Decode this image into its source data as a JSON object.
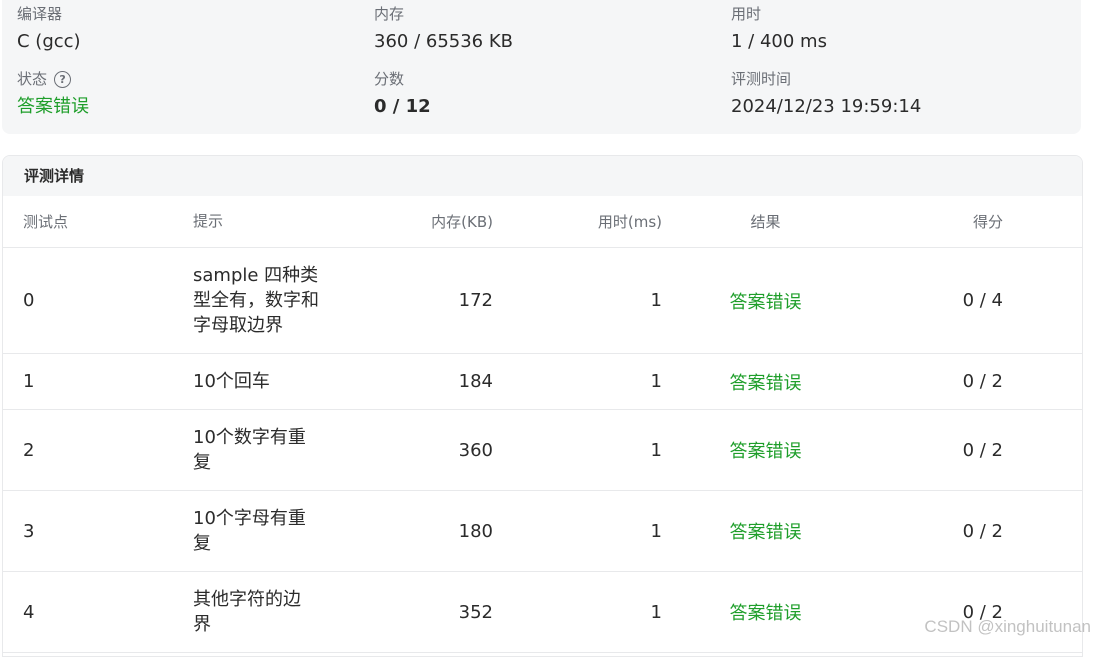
{
  "summary": {
    "compiler_label": "编译器",
    "compiler_value": "C (gcc)",
    "memory_label": "内存",
    "memory_value": "360 / 65536 KB",
    "time_label": "用时",
    "time_value": "1 / 400 ms",
    "status_label": "状态",
    "status_help_icon": "question-circle-icon",
    "status_value": "答案错误",
    "score_label": "分数",
    "score_value": "0 / 12",
    "judge_time_label": "评测时间",
    "judge_time_value": "2024/12/23 19:59:14"
  },
  "details": {
    "title": "评测详情",
    "columns": {
      "id": "测试点",
      "hint": "提示",
      "memory": "内存(KB)",
      "time": "用时(ms)",
      "result": "结果",
      "score": "得分"
    },
    "rows": [
      {
        "id": "0",
        "hint": "sample 四种类型全有，数字和字母取边界",
        "memory": "172",
        "time": "1",
        "result": "答案错误",
        "score": "0 / 4"
      },
      {
        "id": "1",
        "hint": "10个回车",
        "memory": "184",
        "time": "1",
        "result": "答案错误",
        "score": "0 / 2"
      },
      {
        "id": "2",
        "hint": "10个数字有重复",
        "memory": "360",
        "time": "1",
        "result": "答案错误",
        "score": "0 / 2"
      },
      {
        "id": "3",
        "hint": "10个字母有重复",
        "memory": "180",
        "time": "1",
        "result": "答案错误",
        "score": "0 / 2"
      },
      {
        "id": "4",
        "hint": "其他字符的边界",
        "memory": "352",
        "time": "1",
        "result": "答案错误",
        "score": "0 / 2"
      }
    ]
  },
  "watermark": "CSDN @xinghuitunan",
  "colors": {
    "accent_green": "#1e9e2a",
    "panel_bg": "#f5f6f7",
    "border": "#e8e9eb"
  }
}
